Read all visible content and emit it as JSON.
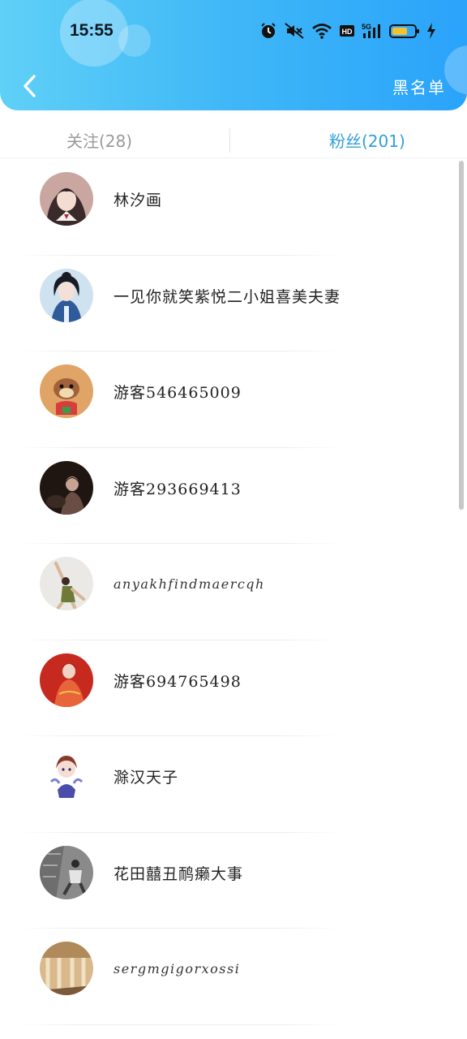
{
  "status_bar": {
    "time": "15:55",
    "icons": [
      "alarm-icon",
      "mute-icon",
      "wifi-icon",
      "hd-icon",
      "5g-signal-icon",
      "battery-icon",
      "charging-icon"
    ]
  },
  "header": {
    "back_icon": "chevron-left-icon",
    "blacklist_label": "黑名单"
  },
  "tabs": [
    {
      "label": "关注(28)",
      "active": false
    },
    {
      "label": "粉丝(201)",
      "active": true
    }
  ],
  "colors": {
    "header_start": "#5fd0f7",
    "header_end": "#2aa3fb",
    "active_tab": "#2ea0dc",
    "inactive_tab": "#9a9a9a"
  },
  "fans": [
    {
      "name": "林汐画",
      "avatar": "anime-girl-avatar"
    },
    {
      "name": "一见你就笑紫悦二小姐喜美夫妻",
      "avatar": "costume-girl-avatar"
    },
    {
      "name": "游客546465009",
      "avatar": "cartoon-dog-avatar"
    },
    {
      "name": "游客293669413",
      "avatar": "dark-photo-avatar"
    },
    {
      "name": "anyakhfindmaercqh",
      "avatar": "dancer-avatar"
    },
    {
      "name": "游客694765498",
      "avatar": "red-dress-avatar"
    },
    {
      "name": "滁汉天子",
      "avatar": "chibi-avatar"
    },
    {
      "name": "花田囍丑鸸癞大事",
      "avatar": "grey-photo-avatar"
    },
    {
      "name": "sergmgigorxossi",
      "avatar": "beige-photo-avatar"
    }
  ]
}
